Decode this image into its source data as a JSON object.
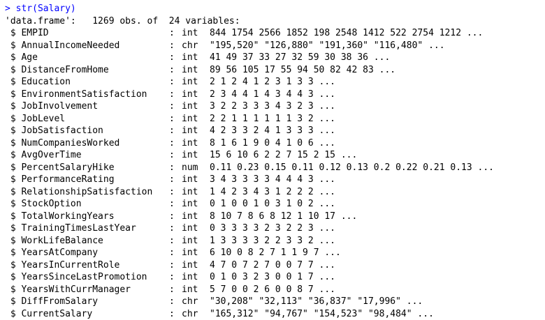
{
  "console": {
    "prompt_symbol": ">",
    "command": "str(Salary)",
    "summary": "'data.frame':   1269 obs. of  24 variables:",
    "variables": [
      {
        "name": " $ EMPID",
        "type": "int",
        "values": "844 1754 2566 1852 198 2548 1412 522 2754 1212 ..."
      },
      {
        "name": " $ AnnualIncomeNeeded",
        "type": "chr",
        "values": "\"195,520\" \"126,880\" \"191,360\" \"116,480\" ..."
      },
      {
        "name": " $ Age",
        "type": "int",
        "values": "41 49 37 33 27 32 59 30 38 36 ..."
      },
      {
        "name": " $ DistanceFromHome",
        "type": "int",
        "values": "89 56 105 17 55 94 50 82 42 83 ..."
      },
      {
        "name": " $ Education",
        "type": "int",
        "values": "2 1 2 4 1 2 3 1 3 3 ..."
      },
      {
        "name": " $ EnvironmentSatisfaction",
        "type": "int",
        "values": "2 3 4 4 1 4 3 4 4 3 ..."
      },
      {
        "name": " $ JobInvolvement",
        "type": "int",
        "values": "3 2 2 3 3 3 4 3 2 3 ..."
      },
      {
        "name": " $ JobLevel",
        "type": "int",
        "values": "2 2 1 1 1 1 1 1 3 2 ..."
      },
      {
        "name": " $ JobSatisfaction",
        "type": "int",
        "values": "4 2 3 3 2 4 1 3 3 3 ..."
      },
      {
        "name": " $ NumCompaniesWorked",
        "type": "int",
        "values": "8 1 6 1 9 0 4 1 0 6 ..."
      },
      {
        "name": " $ AvgOverTime",
        "type": "int",
        "values": "15 6 10 6 2 2 7 15 2 15 ..."
      },
      {
        "name": " $ PercentSalaryHike",
        "type": "num",
        "values": "0.11 0.23 0.15 0.11 0.12 0.13 0.2 0.22 0.21 0.13 ..."
      },
      {
        "name": " $ PerformanceRating",
        "type": "int",
        "values": "3 4 3 3 3 3 4 4 4 3 ..."
      },
      {
        "name": " $ RelationshipSatisfaction",
        "type": "int",
        "values": "1 4 2 3 4 3 1 2 2 2 ..."
      },
      {
        "name": " $ StockOption",
        "type": "int",
        "values": "0 1 0 0 1 0 3 1 0 2 ..."
      },
      {
        "name": " $ TotalWorkingYears",
        "type": "int",
        "values": "8 10 7 8 6 8 12 1 10 17 ..."
      },
      {
        "name": " $ TrainingTimesLastYear",
        "type": "int",
        "values": "0 3 3 3 3 2 3 2 2 3 ..."
      },
      {
        "name": " $ WorkLifeBalance",
        "type": "int",
        "values": "1 3 3 3 3 2 2 3 3 2 ..."
      },
      {
        "name": " $ YearsAtCompany",
        "type": "int",
        "values": "6 10 0 8 2 7 1 1 9 7 ..."
      },
      {
        "name": " $ YearsInCurrentRole",
        "type": "int",
        "values": "4 7 0 7 2 7 0 0 7 7 ..."
      },
      {
        "name": " $ YearsSinceLastPromotion",
        "type": "int",
        "values": "0 1 0 3 2 3 0 0 1 7 ..."
      },
      {
        "name": " $ YearsWithCurrManager",
        "type": "int",
        "values": "5 7 0 0 2 6 0 0 8 7 ..."
      },
      {
        "name": " $ DiffFromSalary",
        "type": "chr",
        "values": "\"30,208\" \"32,113\" \"36,837\" \"17,996\" ..."
      },
      {
        "name": " $ CurrentSalary",
        "type": "chr",
        "values": "\"165,312\" \"94,767\" \"154,523\" \"98,484\" ..."
      }
    ],
    "separator": ":",
    "colors": {
      "command": "#0000ff",
      "output": "#000000",
      "background": "#ffffff"
    }
  }
}
